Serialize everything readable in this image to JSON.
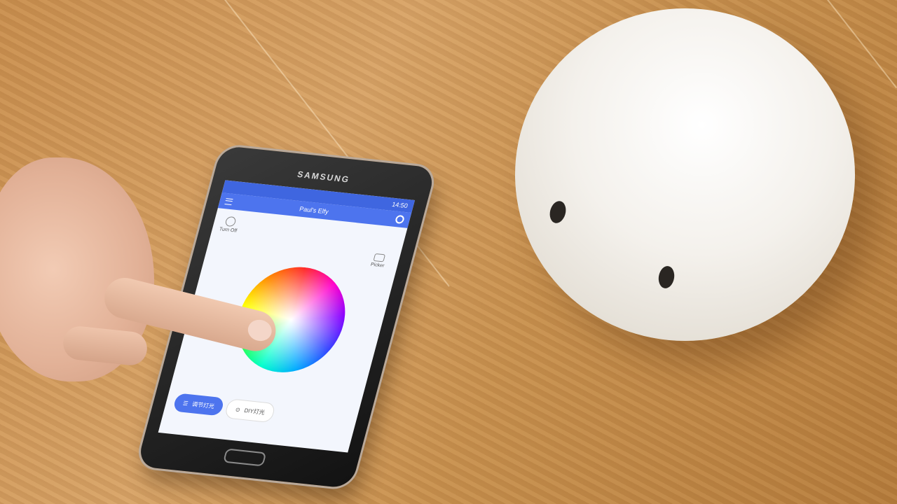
{
  "phone": {
    "brand": "SAMSUNG",
    "status_time": "14:50",
    "app_title": "Paul's Elfy",
    "turn_off_label": "Turn Off",
    "picker_label": "Picker",
    "mode_active_label": "调节灯光",
    "mode_inactive_label": "DIY灯光"
  },
  "colors": {
    "app_blue": "#4d74ee",
    "lamp_white": "#f4f1ec",
    "wood": "#d8a468"
  }
}
